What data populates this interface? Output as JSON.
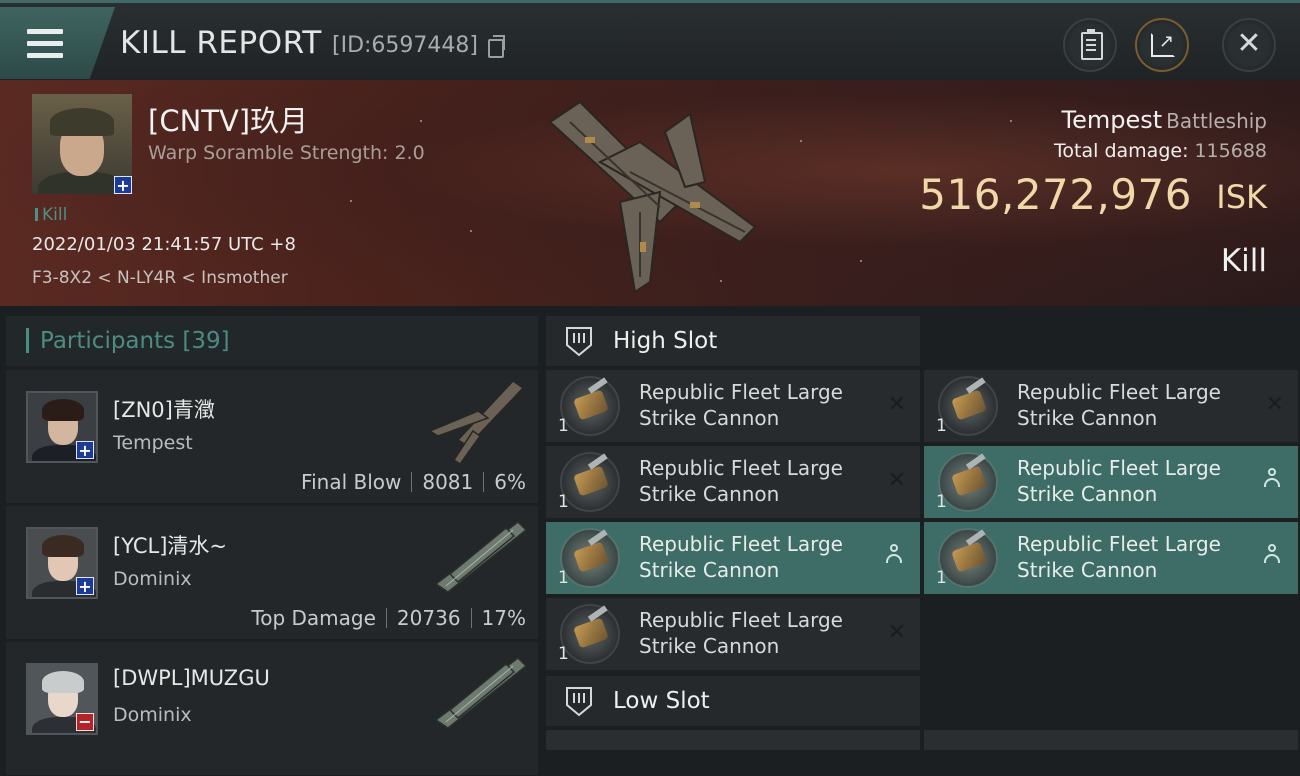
{
  "header": {
    "title": "KILL REPORT",
    "report_id": "[ID:6597448]"
  },
  "victim": {
    "name": "[CNTV]玖月",
    "subtitle": "Warp Soramble Strength: 2.0",
    "kill_tag": "Kill",
    "time": "2022/01/03 21:41:57 UTC +8",
    "location": "F3-8X2 < N-LY4R < Insmother",
    "ship_name": "Tempest",
    "ship_class": "Battleship",
    "damage_label": "Total damage:",
    "damage_value": "115688",
    "isk_value": "516,272,976",
    "isk_unit": "ISK",
    "result": "Kill"
  },
  "participants": {
    "title": "Participants [39]",
    "items": [
      {
        "name": "[ZN0]青瀓",
        "ship": "Tempest",
        "label": "Final Blow",
        "damage": "8081",
        "percent": "6%",
        "badge": "plus"
      },
      {
        "name": "[YCL]清水~",
        "ship": "Dominix",
        "label": "Top Damage",
        "damage": "20736",
        "percent": "17%",
        "badge": "plus"
      },
      {
        "name": "[DWPL]MUZGU",
        "ship": "Dominix",
        "label": "",
        "damage": "",
        "percent": "",
        "badge": "minus"
      }
    ]
  },
  "high_slot": {
    "title": "High Slot",
    "modules": [
      {
        "name": "Republic Fleet Large Strike Cannon",
        "line1": "Republic Fleet Large",
        "line2": "Strike Cannon",
        "qty": "1",
        "state": "destroyed"
      },
      {
        "name": "Republic Fleet Large Strike Cannon",
        "line1": "Republic Fleet Large",
        "line2": "Strike Cannon",
        "qty": "1",
        "state": "destroyed"
      },
      {
        "name": "Republic Fleet Large Strike Cannon",
        "line1": "Republic Fleet Large",
        "line2": "Strike Cannon",
        "qty": "1",
        "state": "destroyed"
      },
      {
        "name": "Republic Fleet Large Strike Cannon",
        "line1": "Republic Fleet Large",
        "line2": "Strike Cannon",
        "qty": "1",
        "state": "dropped"
      },
      {
        "name": "Republic Fleet Large Strike Cannon",
        "line1": "Republic Fleet Large",
        "line2": "Strike Cannon",
        "qty": "1",
        "state": "dropped"
      },
      {
        "name": "Republic Fleet Large Strike Cannon",
        "line1": "Republic Fleet Large",
        "line2": "Strike Cannon",
        "qty": "1",
        "state": "dropped"
      },
      {
        "name": "Republic Fleet Large Strike Cannon",
        "line1": "Republic Fleet Large",
        "line2": "Strike Cannon",
        "qty": "1",
        "state": "destroyed"
      }
    ]
  },
  "low_slot": {
    "title": "Low Slot"
  },
  "icons": {
    "menu": "hamburger-icon",
    "copy": "copy-icon",
    "clipboard": "clipboard-icon",
    "share": "share-icon",
    "close": "close-icon",
    "destroyed": "x-mark-icon",
    "dropped": "person-icon"
  },
  "colors": {
    "accent": "#4d8c83",
    "isk": "#f0d8a8",
    "active_slot": "#3d6d66"
  }
}
